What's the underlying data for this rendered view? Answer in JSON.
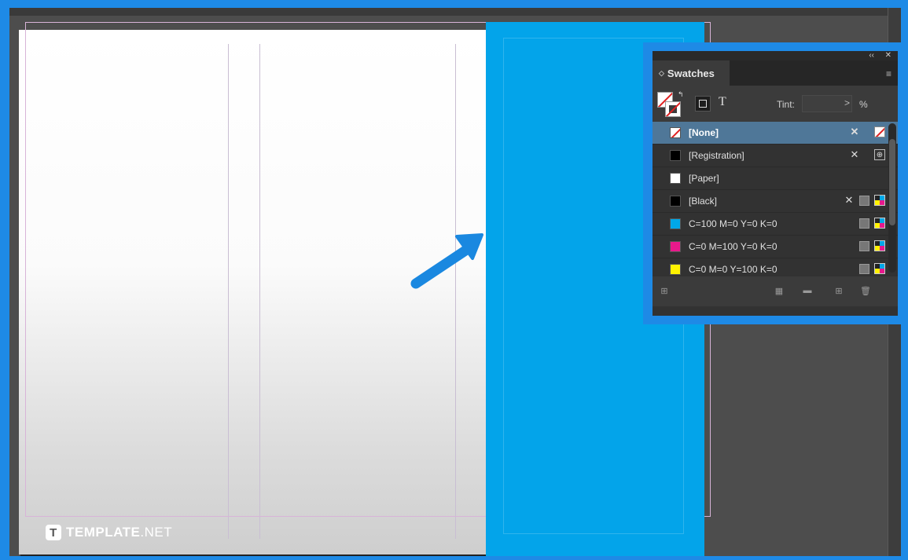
{
  "canvas": {
    "logo_text_bold": "TEMPLATE",
    "logo_text_light": ".NET",
    "logo_letter": "T"
  },
  "swatches_panel": {
    "collapse_glyph": "‹‹",
    "close_glyph": "✕",
    "tab_label": "Swatches",
    "tab_glyph": "◇",
    "menu_glyph": "≡",
    "text_toggle": "T",
    "tint_label": "Tint:",
    "tint_value": "",
    "tint_arrow": ">",
    "tint_unit": "%",
    "items": [
      {
        "name": "[None]",
        "color": "none",
        "icons": [
          "no-edit",
          "none-mode"
        ]
      },
      {
        "name": "[Registration]",
        "color": "#000000",
        "icons": [
          "no-edit",
          "registration-mode"
        ]
      },
      {
        "name": "[Paper]",
        "color": "#ffffff",
        "icons": []
      },
      {
        "name": "[Black]",
        "color": "#000000",
        "icons": [
          "no-edit",
          "process",
          "cmyk"
        ]
      },
      {
        "name": "C=100 M=0 Y=0 K=0",
        "color": "#00a8e8",
        "icons": [
          "process",
          "cmyk"
        ]
      },
      {
        "name": "C=0 M=100 Y=0 K=0",
        "color": "#e8198b",
        "icons": [
          "process",
          "cmyk"
        ]
      },
      {
        "name": "C=0 M=0 Y=100 K=0",
        "color": "#fff200",
        "icons": [
          "process",
          "cmyk"
        ]
      }
    ],
    "selected_index": 0
  },
  "colors": {
    "frame_blue": "#1e8ae6",
    "spread_blue": "#03a4ea",
    "arrow_blue": "#1a88e0",
    "selected_row": "#4f7798"
  }
}
